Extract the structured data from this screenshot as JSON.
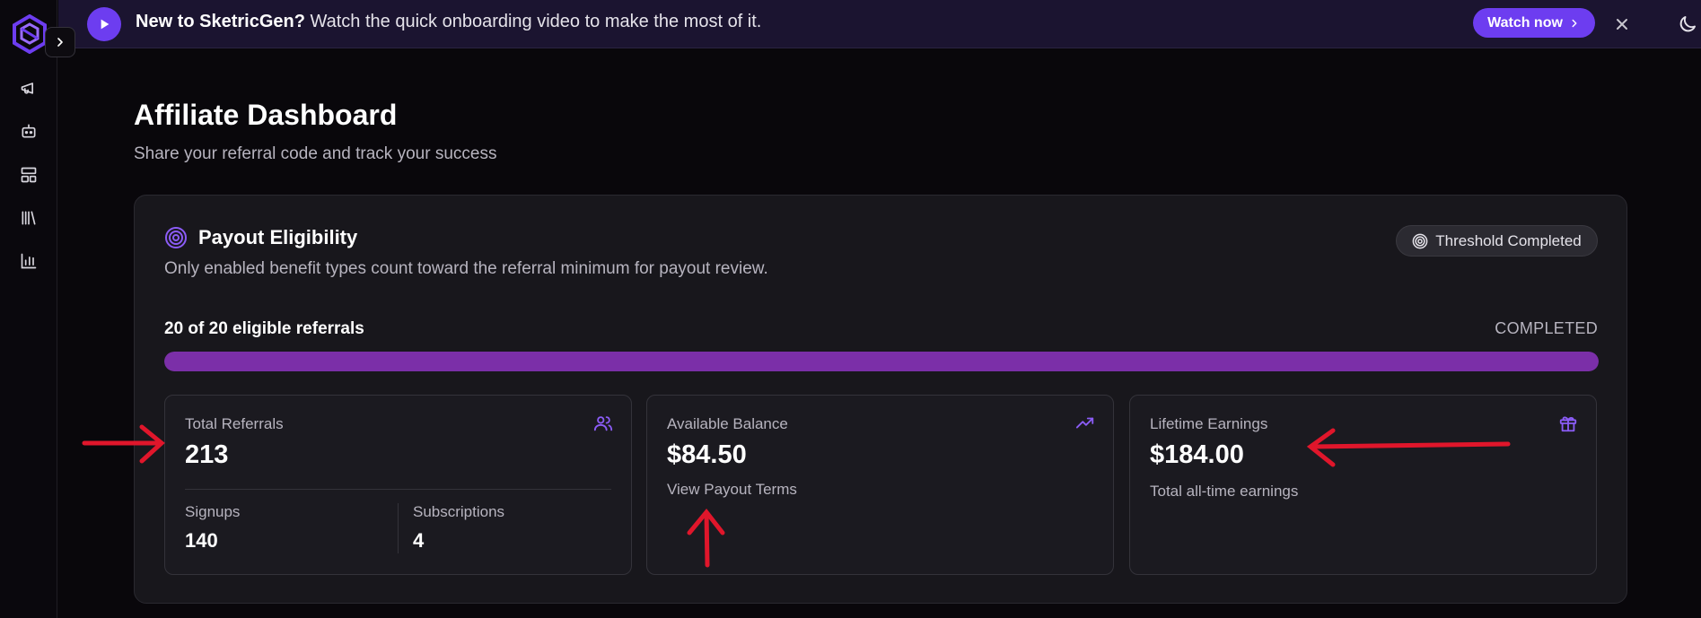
{
  "banner": {
    "bold": "New to SketricGen?",
    "text": " Watch the quick onboarding video to make the most of it.",
    "watch_label": "Watch now"
  },
  "page": {
    "title": "Affiliate Dashboard",
    "subtitle": "Share your referral code and track your success"
  },
  "eligibility": {
    "title": "Payout Eligibility",
    "description": "Only enabled benefit types count toward the referral minimum for payout review.",
    "badge": "Threshold Completed",
    "progress_label": "20 of 20 eligible referrals",
    "progress_status": "COMPLETED",
    "progress_fraction": 1.0
  },
  "stats": {
    "referrals": {
      "label": "Total Referrals",
      "value": "213",
      "signups_label": "Signups",
      "signups_value": "140",
      "subscriptions_label": "Subscriptions",
      "subscriptions_value": "4"
    },
    "balance": {
      "label": "Available Balance",
      "value": "$84.50",
      "link": "View Payout Terms"
    },
    "lifetime": {
      "label": "Lifetime Earnings",
      "value": "$184.00",
      "note": "Total all-time earnings"
    }
  },
  "colors": {
    "accent": "#6d3df0",
    "progress": "#7b2fa8",
    "annotation": "#e0162b"
  },
  "icons": {
    "sidebar": [
      "megaphone-icon",
      "bot-icon",
      "layout-icon",
      "library-icon",
      "bar-chart-icon"
    ]
  }
}
